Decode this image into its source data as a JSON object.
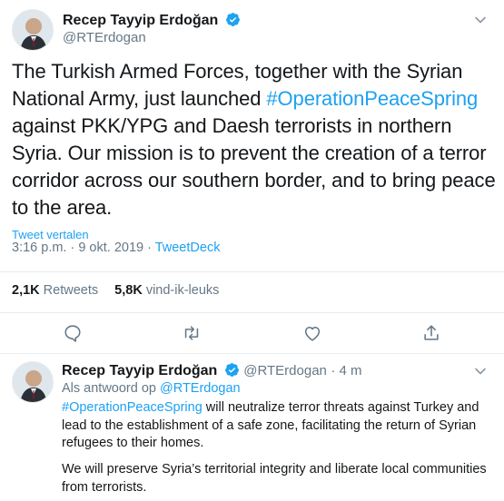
{
  "tweet": {
    "author_name": "Recep Tayyip Erdoğan",
    "author_handle": "@RTErdogan",
    "text_part1": "The Turkish Armed Forces, together with the Syrian National Army, just launched ",
    "hashtag": "#OperationPeaceSpring",
    "text_part2": " against PKK/YPG and Daesh terrorists in northern Syria. Our mission is to prevent the creation of a terror corridor across our southern border, and to bring peace to the area.",
    "translate_label": "Tweet vertalen",
    "time": "3:16 p.m.",
    "separator": " · ",
    "date": "9 okt. 2019",
    "source": "TweetDeck",
    "retweets_count": "2,1K",
    "retweets_label": "Retweets",
    "likes_count": "5,8K",
    "likes_label": "vind-ik-leuks"
  },
  "reply": {
    "author_name": "Recep Tayyip Erdoğan",
    "author_handle": "@RTErdogan",
    "age": "· 4 m",
    "reply_to_label": "Als antwoord op",
    "reply_to_handle": "@RTErdogan",
    "hashtag": "#OperationPeaceSpring",
    "text_part1": " will neutralize terror threats against Turkey and lead to the establishment of a safe zone, facilitating the return of Syrian refugees to their homes.",
    "text_part2": "We will preserve Syria’s territorial integrity and liberate local communities from terrorists."
  },
  "icons": {
    "verified": "verified-badge-icon",
    "chevron": "chevron-down-icon",
    "reply": "reply-icon",
    "retweet": "retweet-icon",
    "like": "like-icon",
    "share": "share-icon"
  },
  "colors": {
    "accent": "#1da1f2",
    "text": "#14171a",
    "secondary": "#657786",
    "divider": "#e6ecf0"
  }
}
